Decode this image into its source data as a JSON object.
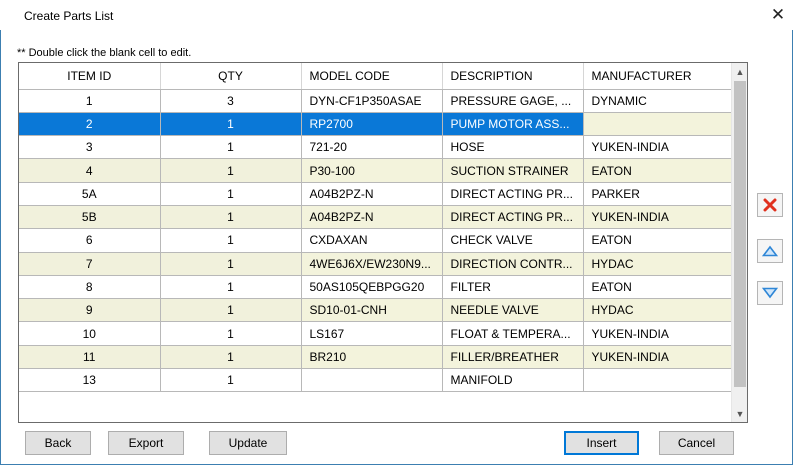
{
  "window": {
    "title": "Create Parts List",
    "close_glyph": "✕"
  },
  "hint": "** Double click the blank cell to edit.",
  "table": {
    "columns": [
      "ITEM ID",
      "QTY",
      "MODEL CODE",
      "DESCRIPTION",
      "MANUFACTURER"
    ],
    "selected_row_index": 1,
    "rows": [
      {
        "item_id": "1",
        "qty": "3",
        "model_code": "DYN-CF1P350ASAE",
        "description": "PRESSURE GAGE, ...",
        "manufacturer": "DYNAMIC"
      },
      {
        "item_id": "2",
        "qty": "1",
        "model_code": "RP2700",
        "description": "PUMP MOTOR ASS...",
        "manufacturer": ""
      },
      {
        "item_id": "3",
        "qty": "1",
        "model_code": "721-20",
        "description": "HOSE",
        "manufacturer": "YUKEN-INDIA"
      },
      {
        "item_id": "4",
        "qty": "1",
        "model_code": "P30-100",
        "description": "SUCTION STRAINER",
        "manufacturer": "EATON"
      },
      {
        "item_id": "5A",
        "qty": "1",
        "model_code": "A04B2PZ-N",
        "description": "DIRECT ACTING PR...",
        "manufacturer": "PARKER"
      },
      {
        "item_id": "5B",
        "qty": "1",
        "model_code": "A04B2PZ-N",
        "description": "DIRECT ACTING PR...",
        "manufacturer": "YUKEN-INDIA"
      },
      {
        "item_id": "6",
        "qty": "1",
        "model_code": "CXDAXAN",
        "description": "CHECK VALVE",
        "manufacturer": "EATON"
      },
      {
        "item_id": "7",
        "qty": "1",
        "model_code": "4WE6J6X/EW230N9...",
        "description": "DIRECTION CONTR...",
        "manufacturer": "HYDAC"
      },
      {
        "item_id": "8",
        "qty": "1",
        "model_code": "50AS105QEBPGG20",
        "description": "FILTER",
        "manufacturer": "EATON"
      },
      {
        "item_id": "9",
        "qty": "1",
        "model_code": "SD10-01-CNH",
        "description": "NEEDLE VALVE",
        "manufacturer": "HYDAC"
      },
      {
        "item_id": "10",
        "qty": "1",
        "model_code": "LS167",
        "description": "FLOAT & TEMPERA...",
        "manufacturer": "YUKEN-INDIA"
      },
      {
        "item_id": "11",
        "qty": "1",
        "model_code": "BR210",
        "description": "FILLER/BREATHER",
        "manufacturer": "YUKEN-INDIA"
      },
      {
        "item_id": "13",
        "qty": "1",
        "model_code": "",
        "description": "MANIFOLD",
        "manufacturer": ""
      }
    ]
  },
  "side_buttons": {
    "delete_icon": "delete-x-icon",
    "move_up_icon": "triangle-up-icon",
    "move_down_icon": "triangle-down-icon"
  },
  "buttons": {
    "back": "Back",
    "export": "Export",
    "update": "Update",
    "insert": "Insert",
    "cancel": "Cancel"
  },
  "colors": {
    "selection": "#0a78d7",
    "alt_row": "#f3f3dc",
    "delete_red": "#e0301e",
    "arrow_blue": "#2e86d6"
  }
}
